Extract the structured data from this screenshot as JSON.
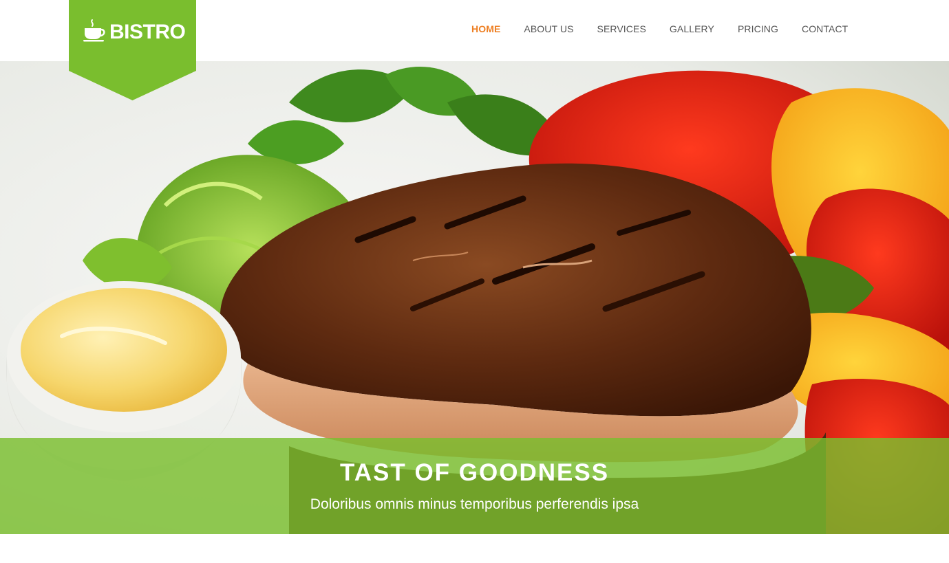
{
  "logo": {
    "text": "BISTRO",
    "icon": "coffee-cup-icon",
    "badge_color": "#7abe2e"
  },
  "nav": {
    "items": [
      {
        "label": "HOME",
        "active": true
      },
      {
        "label": "ABOUT US",
        "active": false
      },
      {
        "label": "SERVICES",
        "active": false
      },
      {
        "label": "GALLERY",
        "active": false
      },
      {
        "label": "PRICING",
        "active": false
      },
      {
        "label": "CONTACT",
        "active": false
      }
    ],
    "active_color": "#ee7f23",
    "text_color": "#555555"
  },
  "hero": {
    "image": "grilled-meat-with-vegetables-and-sauce",
    "caption": {
      "title": "TAST OF GOODNESS",
      "subtitle": "Doloribus omnis minus temporibus perferendis ipsa"
    },
    "caption_bg_color": "#7abe2e"
  }
}
